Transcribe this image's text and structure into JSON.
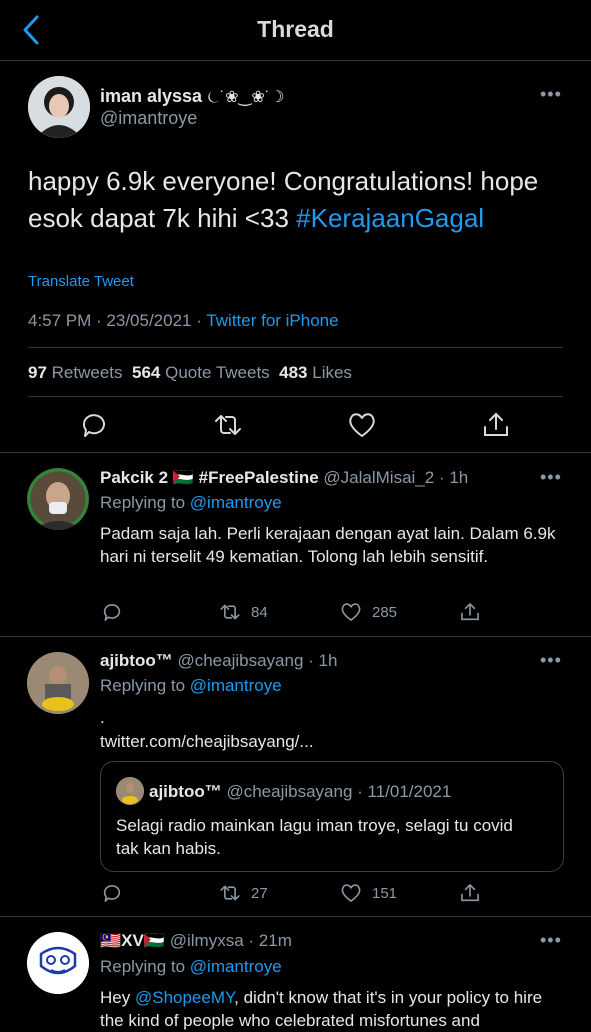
{
  "header": {
    "title": "Thread"
  },
  "main_tweet": {
    "author": "iman alyssa",
    "author_decor": "⏾˙❀‿❀˙☽",
    "handle": "@imantroye",
    "text": "happy 6.9k everyone! Congratulations! hope esok dapat 7k hihi <33",
    "hashtag": "#KerajaanGagal",
    "translate": "Translate Tweet",
    "meta": "4:57 PM · 23/05/2021 · ",
    "source": "Twitter for iPhone",
    "retweets_count": "97",
    "retweets_label": "Retweets",
    "quotes_count": "564",
    "quotes_label": "Quote Tweets",
    "likes_count": "483",
    "likes_label": "Likes"
  },
  "replies": [
    {
      "name": "Pakcik 2 🇵🇸 #FreePalestine",
      "handle_time": "@JalalMisai_2 · 1h",
      "replying_label": "Replying to ",
      "replying_handle": "@imantroye",
      "text": "Padam saja lah. Perli kerajaan dengan ayat lain. Dalam 6.9k hari ni terselit 49 kematian. Tolong lah lebih sensitif.",
      "retweets": "84",
      "likes": "285"
    },
    {
      "name": "ajibtoo™",
      "handle_time": "@cheajibsayang · 1h",
      "replying_label": "Replying to ",
      "replying_handle": "@imantroye",
      "text": ".",
      "link": "twitter.com/cheajibsayang/...",
      "quote_name": "ajibtoo™",
      "quote_handle_time": "@cheajibsayang · 11/01/2021",
      "quote_text": "Selagi radio mainkan lagu iman troye, selagi tu covid tak kan habis.",
      "retweets": "27",
      "likes": "151"
    },
    {
      "name": "🇲🇾XV🇵🇸",
      "handle_time": "@ilmyxsa · 21m",
      "replying_label": "Replying to ",
      "replying_handle": "@imantroye",
      "text_prefix": "Hey ",
      "mention": "@ShopeeMY",
      "text_suffix": ", didn't know that it's in your policy to hire the kind of people who celebrated misfortunes and"
    }
  ],
  "colors": {
    "link": "#1d9bf0",
    "muted": "#8b98a5",
    "background": "#000000"
  }
}
